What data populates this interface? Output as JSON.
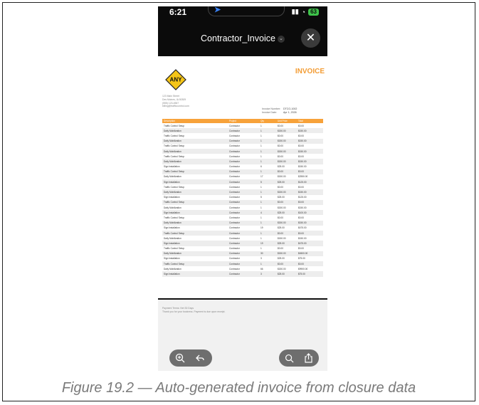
{
  "status": {
    "time": "6:21",
    "battery": "63"
  },
  "document": {
    "title": "Contractor_Invoice"
  },
  "invoice": {
    "logo_text": "ANY",
    "heading": "INVOICE",
    "address_lines": [
      "123 Main Street",
      "Des Moines, IA 50309",
      "(555) 123-4567",
      "billing@trafficcontrol.com"
    ],
    "invoice_number_label": "Invoice Number:",
    "invoice_number": "DTCO-1002",
    "invoice_date_label": "Invoice Date:",
    "invoice_date": "Apr 1, 2026",
    "columns": [
      "Description",
      "Project",
      "Qty",
      "Unit Price",
      "Total"
    ],
    "rows": [
      [
        "Traffic Control Setup",
        "Contractor",
        "1",
        "$0.00",
        "$0.00"
      ],
      [
        "Daily Mobilization",
        "Contractor",
        "1",
        "$150.00",
        "$150.00"
      ],
      [
        "Traffic Control Setup",
        "Contractor",
        "1",
        "$0.00",
        "$0.00"
      ],
      [
        "Daily Mobilization",
        "Contractor",
        "1",
        "$150.00",
        "$150.00"
      ],
      [
        "Traffic Control Setup",
        "Contractor",
        "1",
        "$0.00",
        "$0.00"
      ],
      [
        "Daily Mobilization",
        "Contractor",
        "1",
        "$150.00",
        "$150.00"
      ],
      [
        "Traffic Control Setup",
        "Contractor",
        "1",
        "$0.00",
        "$0.00"
      ],
      [
        "Daily Mobilization",
        "Contractor",
        "1",
        "$150.00",
        "$150.00"
      ],
      [
        "Sign Installation",
        "Contractor",
        "6",
        "$25.00",
        "$150.00"
      ],
      [
        "Traffic Control Setup",
        "Contractor",
        "1",
        "$0.00",
        "$0.00"
      ],
      [
        "Daily Mobilization",
        "Contractor",
        "17",
        "$150.00",
        "$2550.00"
      ],
      [
        "Sign Installation",
        "Contractor",
        "5",
        "$25.00",
        "$125.00"
      ],
      [
        "Traffic Control Setup",
        "Contractor",
        "1",
        "$0.00",
        "$0.00"
      ],
      [
        "Daily Mobilization",
        "Contractor",
        "1",
        "$150.00",
        "$150.00"
      ],
      [
        "Sign Installation",
        "Contractor",
        "5",
        "$25.00",
        "$125.00"
      ],
      [
        "Traffic Control Setup",
        "Contractor",
        "1",
        "$0.00",
        "$0.00"
      ],
      [
        "Daily Mobilization",
        "Contractor",
        "1",
        "$150.00",
        "$150.00"
      ],
      [
        "Sign Installation",
        "Contractor",
        "4",
        "$25.00",
        "$100.00"
      ],
      [
        "Traffic Control Setup",
        "Contractor",
        "1",
        "$0.00",
        "$0.00"
      ],
      [
        "Daily Mobilization",
        "Contractor",
        "1",
        "$150.00",
        "$150.00"
      ],
      [
        "Sign Installation",
        "Contractor",
        "19",
        "$25.00",
        "$475.00"
      ],
      [
        "Traffic Control Setup",
        "Contractor",
        "1",
        "$0.00",
        "$0.00"
      ],
      [
        "Daily Mobilization",
        "Contractor",
        "1",
        "$150.00",
        "$150.00"
      ],
      [
        "Sign Installation",
        "Contractor",
        "19",
        "$25.00",
        "$475.00"
      ],
      [
        "Traffic Control Setup",
        "Contractor",
        "1",
        "$0.00",
        "$0.00"
      ],
      [
        "Daily Mobilization",
        "Contractor",
        "30",
        "$150.00",
        "$4500.00"
      ],
      [
        "Sign Installation",
        "Contractor",
        "3",
        "$25.00",
        "$75.00"
      ],
      [
        "Traffic Control Setup",
        "Contractor",
        "1",
        "$0.00",
        "$0.00"
      ],
      [
        "Daily Mobilization",
        "Contractor",
        "66",
        "$150.00",
        "$9900.00"
      ],
      [
        "Sign Installation",
        "Contractor",
        "3",
        "$25.00",
        "$75.00"
      ]
    ],
    "footer_lines": [
      "Payment Terms: Net 30 Days",
      "Thank you for your business. Payment is due upon receipt."
    ]
  },
  "caption": "Figure 19.2 — Auto-generated invoice from closure data",
  "icons": {
    "zoom": "zoom-in-icon",
    "back": "reply-back-icon",
    "search": "search-icon",
    "share": "share-icon",
    "close": "close-icon"
  },
  "colors": {
    "accent": "#f7a23a",
    "heading": "#f39c34"
  }
}
